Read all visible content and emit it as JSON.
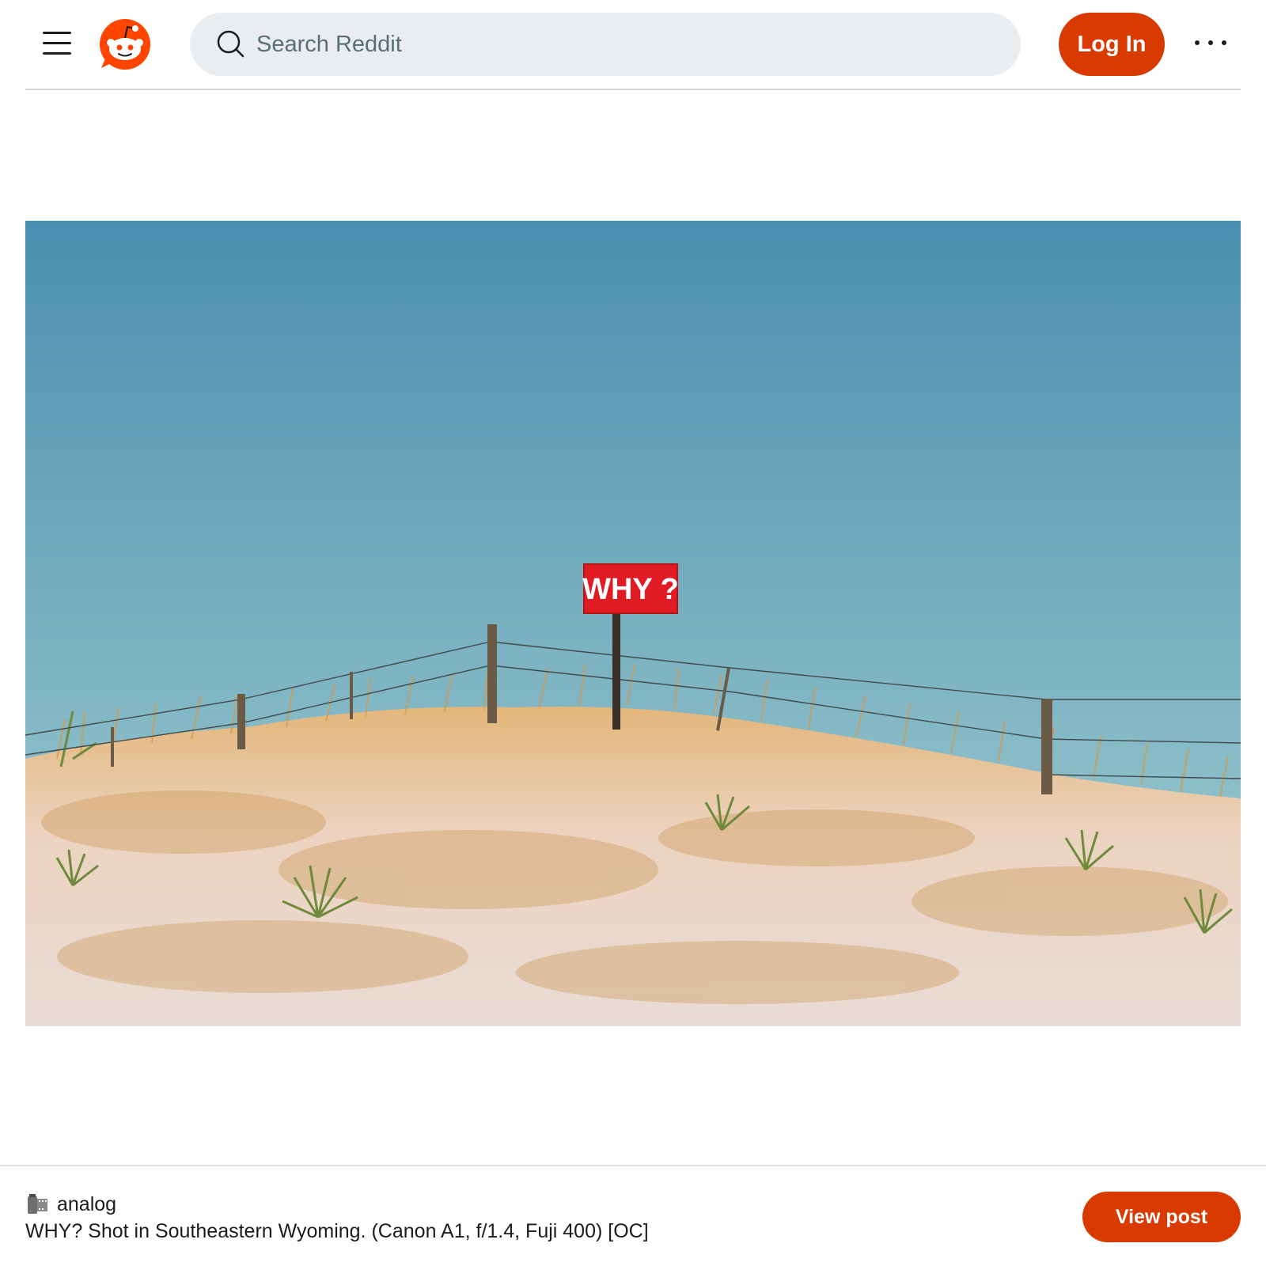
{
  "header": {
    "search_placeholder": "Search Reddit",
    "login_label": "Log In"
  },
  "photo": {
    "sign_text": "WHY ?"
  },
  "post": {
    "subreddit": "analog",
    "title": "WHY? Shot in Southeastern Wyoming. (Canon A1, f/1.4, Fuji 400) [OC]",
    "view_label": "View post"
  },
  "colors": {
    "accent": "#d93a00",
    "search_bg": "#e9edf0",
    "sky_top": "#4a8fb0",
    "sky_bottom": "#9cccd4",
    "sign_red": "#e01b24",
    "grass": "#d8a560",
    "snow": "#f0e8e6"
  },
  "icons": [
    "menu-icon",
    "reddit-logo",
    "search-icon",
    "more-icon",
    "film-roll-icon"
  ]
}
